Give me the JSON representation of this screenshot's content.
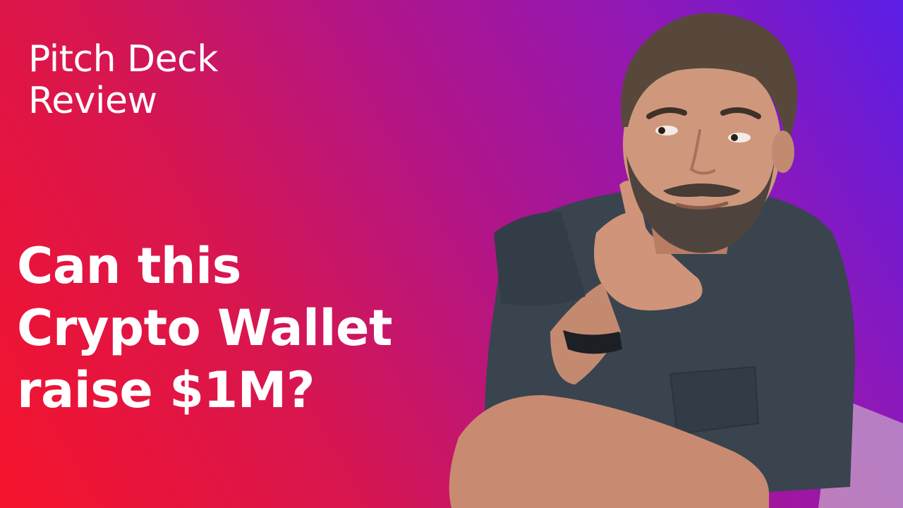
{
  "thumbnail": {
    "subtitle_line1": "Pitch Deck",
    "subtitle_line2": "Review",
    "headline_line1": "Can this",
    "headline_line2": "Crypto Wallet",
    "headline_line3": "raise $1M?"
  },
  "colors": {
    "gradient_start": "#f5132b",
    "gradient_mid": "#b0158a",
    "gradient_end": "#5a1ee6",
    "text": "#ffffff",
    "shirt": "#3a4550",
    "skin": "#c98e73",
    "hair": "#5a4a3c"
  },
  "icons": {
    "person": "man-thinking-photo"
  }
}
